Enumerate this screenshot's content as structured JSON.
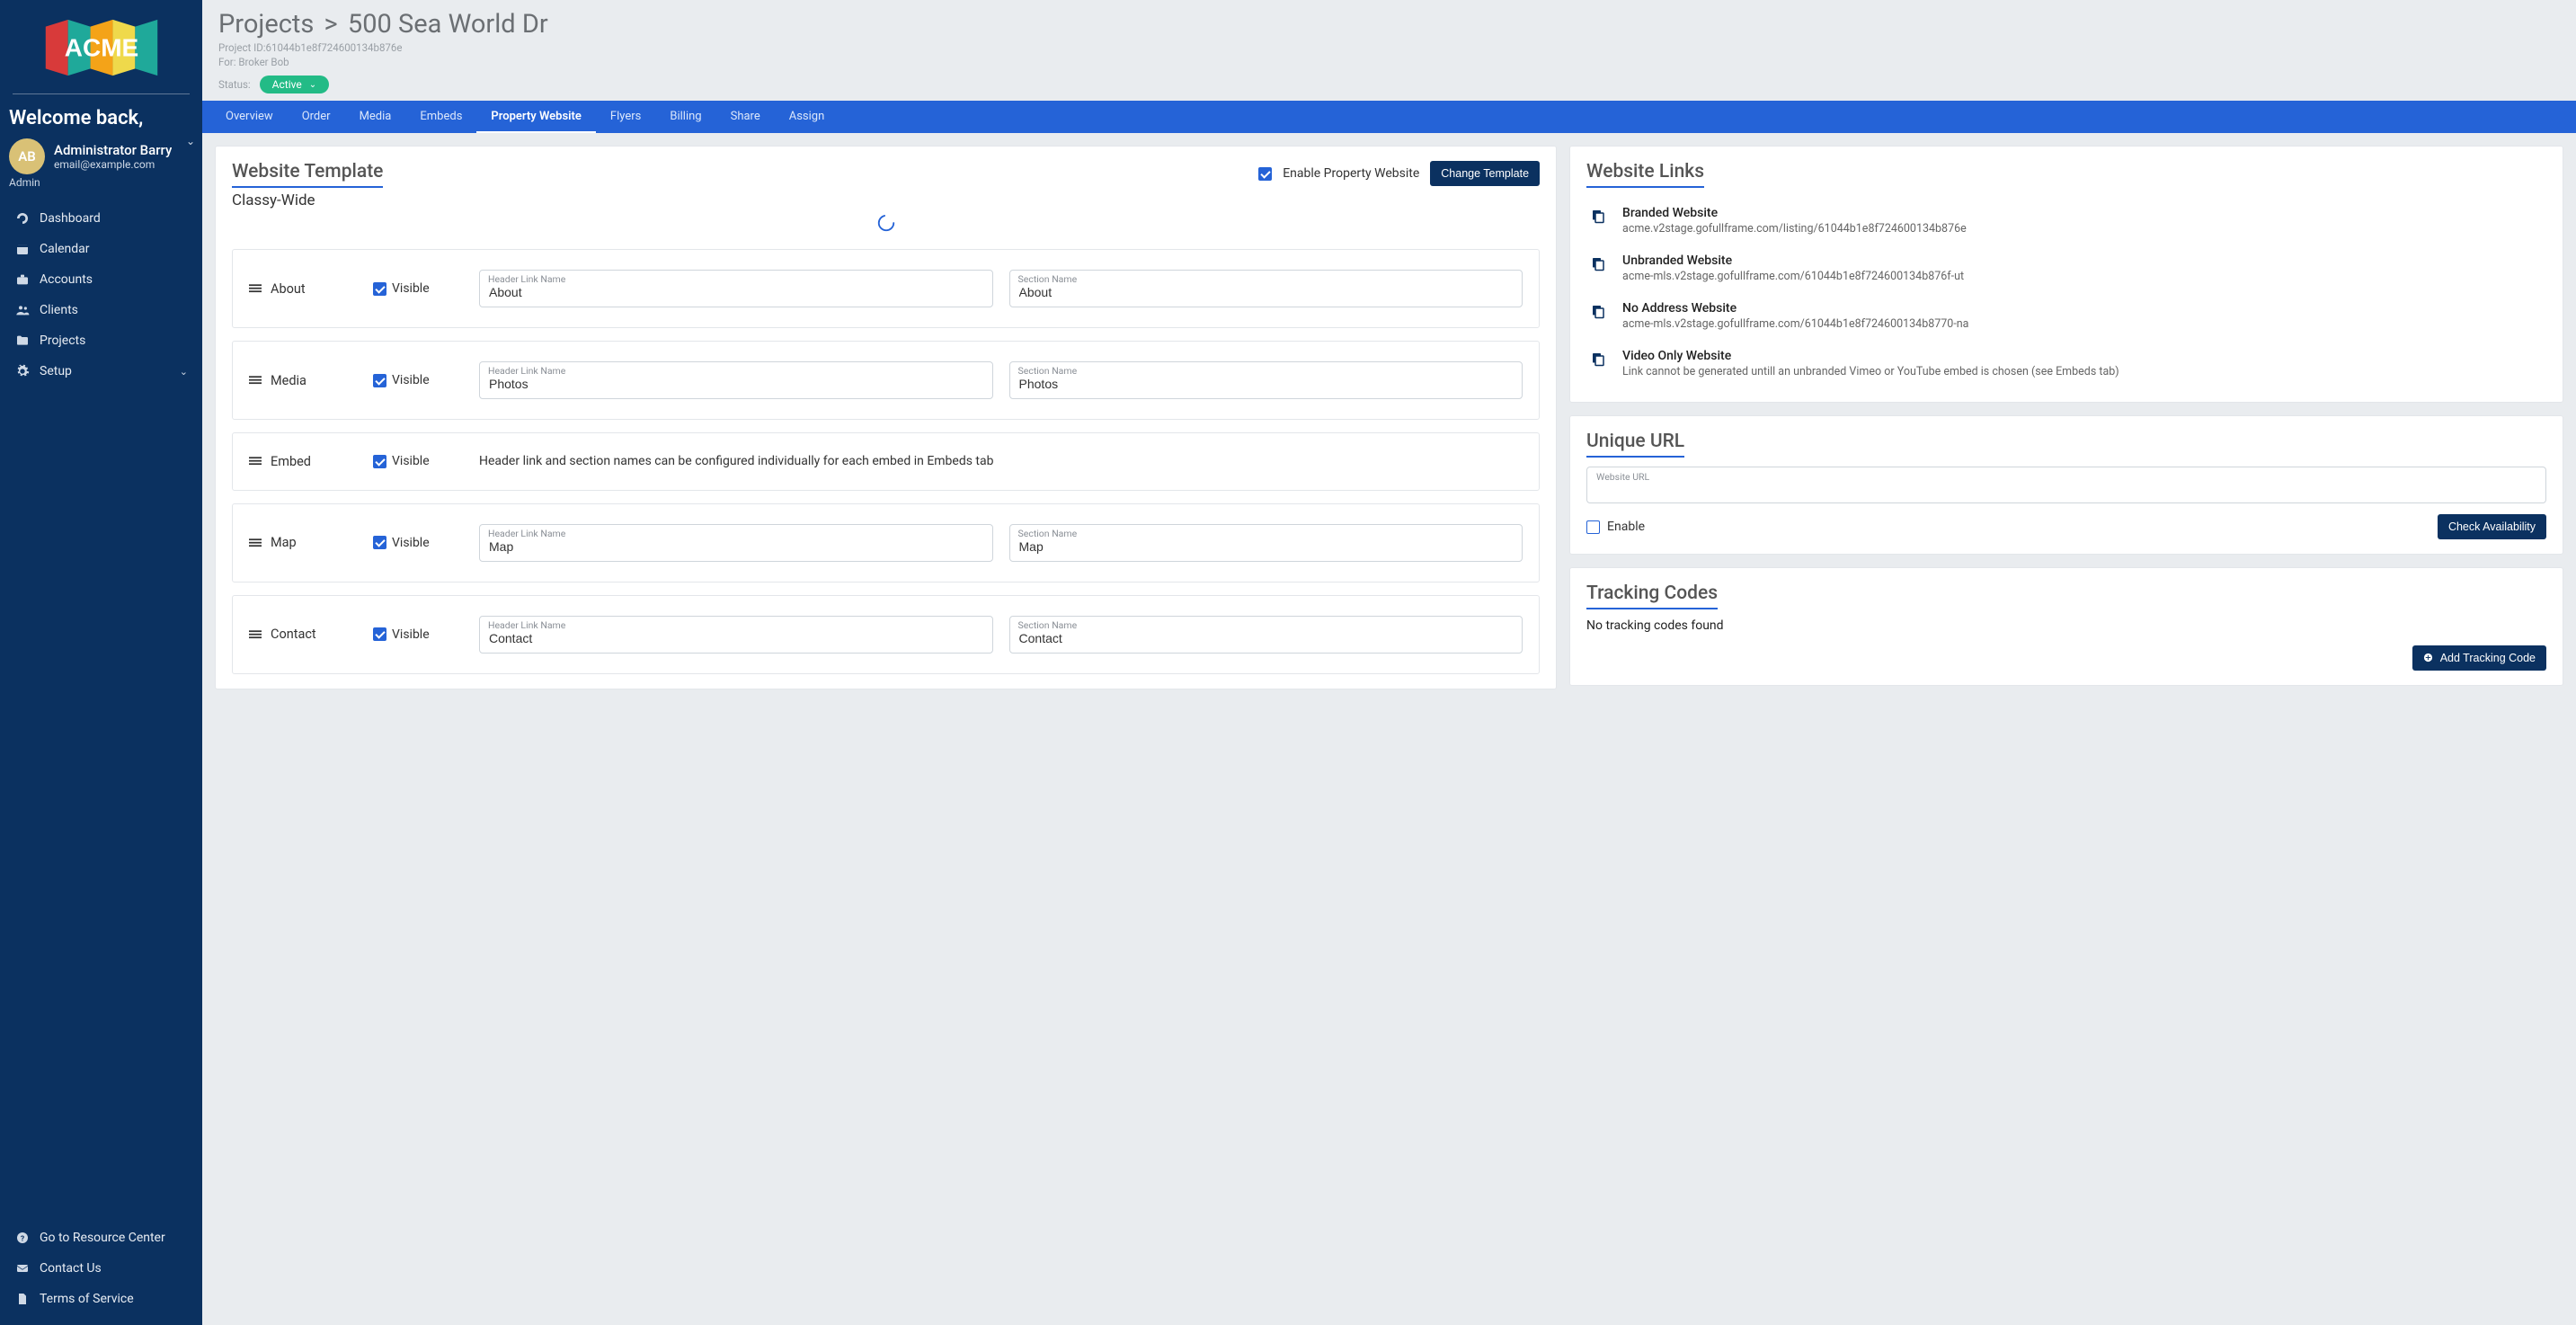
{
  "sidebar": {
    "welcome": "Welcome back,",
    "user": {
      "initials": "AB",
      "name": "Administrator Barry",
      "email": "email@example.com",
      "role": "Admin"
    },
    "nav": [
      {
        "label": "Dashboard",
        "icon": "gauge"
      },
      {
        "label": "Calendar",
        "icon": "calendar"
      },
      {
        "label": "Accounts",
        "icon": "briefcase"
      },
      {
        "label": "Clients",
        "icon": "users"
      },
      {
        "label": "Projects",
        "icon": "folder"
      },
      {
        "label": "Setup",
        "icon": "gear",
        "expandable": true
      }
    ],
    "foot": [
      {
        "label": "Go to Resource Center",
        "icon": "help"
      },
      {
        "label": "Contact Us",
        "icon": "mail"
      },
      {
        "label": "Terms of Service",
        "icon": "doc"
      }
    ]
  },
  "header": {
    "crumb_root": "Projects",
    "crumb_leaf": "500 Sea World Dr",
    "project_id_label": "Project ID:",
    "project_id": "61044b1e8f724600134b876e",
    "for_label": "For:",
    "for_value": "Broker Bob",
    "status_label": "Status:",
    "status_value": "Active"
  },
  "tabs": [
    {
      "label": "Overview"
    },
    {
      "label": "Order"
    },
    {
      "label": "Media"
    },
    {
      "label": "Embeds"
    },
    {
      "label": "Property Website",
      "active": true
    },
    {
      "label": "Flyers"
    },
    {
      "label": "Billing"
    },
    {
      "label": "Share"
    },
    {
      "label": "Assign"
    }
  ],
  "template": {
    "title": "Website Template",
    "enable_label": "Enable Property Website",
    "change_btn": "Change Template",
    "name": "Classy-Wide",
    "header_link_label": "Header Link Name",
    "section_name_label": "Section Name",
    "visible_label": "Visible",
    "rows": [
      {
        "name": "About",
        "header_link": "About",
        "section": "About"
      },
      {
        "name": "Media",
        "header_link": "Photos",
        "section": "Photos"
      },
      {
        "name": "Embed",
        "note": "Header link and section names can be configured individually for each embed in Embeds tab"
      },
      {
        "name": "Map",
        "header_link": "Map",
        "section": "Map"
      },
      {
        "name": "Contact",
        "header_link": "Contact",
        "section": "Contact"
      }
    ]
  },
  "links": {
    "title": "Website Links",
    "items": [
      {
        "title": "Branded Website",
        "url": "acme.v2stage.gofullframe.com/listing/61044b1e8f724600134b876e"
      },
      {
        "title": "Unbranded Website",
        "url": "acme-mls.v2stage.gofullframe.com/61044b1e8f724600134b876f-ut"
      },
      {
        "title": "No Address Website",
        "url": "acme-mls.v2stage.gofullframe.com/61044b1e8f724600134b8770-na"
      },
      {
        "title": "Video Only Website",
        "url": "Link cannot be generated untill an unbranded Vimeo or YouTube embed is chosen (see Embeds tab)"
      }
    ]
  },
  "unique_url": {
    "title": "Unique URL",
    "field_label": "Website URL",
    "enable_label": "Enable",
    "check_btn": "Check Availability"
  },
  "tracking": {
    "title": "Tracking Codes",
    "none_msg": "No tracking codes found",
    "add_btn": "Add Tracking Code"
  }
}
